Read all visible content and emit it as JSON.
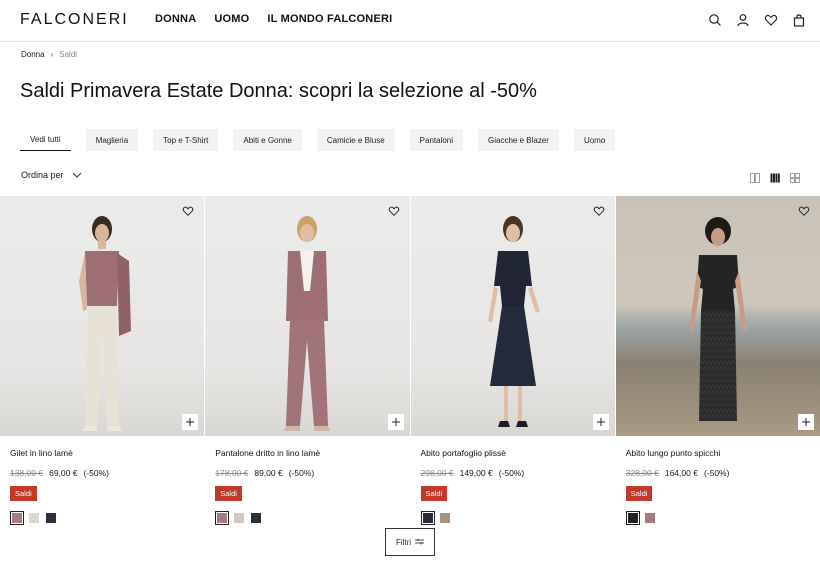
{
  "brand": "FALCONERI",
  "nav": [
    "DONNA",
    "UOMO",
    "IL MONDO FALCONERI"
  ],
  "header_icons": [
    "search-icon",
    "account-icon",
    "wishlist-icon",
    "bag-icon"
  ],
  "breadcrumb": {
    "root": "Donna",
    "separator": "›",
    "current": "Saldi"
  },
  "title": "Saldi Primavera Estate Donna: scopri la selezione al -50%",
  "chips": [
    "Vedi tutti",
    "Maglieria",
    "Top e T-Shirt",
    "Abiti e Gonne",
    "Camicie e Bluse",
    "Pantaloni",
    "Giacche e Blazer",
    "Uomo"
  ],
  "sort_label": "Ordina per",
  "view_icons": [
    "grid-2-icon",
    "grid-4-icon",
    "grid-6-icon"
  ],
  "badge_label": "Saldi",
  "filter_label": "Filtri",
  "products": [
    {
      "name": "Gilet in lino lamè",
      "old_price": "138,00 €",
      "new_price": "69,00 €",
      "discount": "(-50%)",
      "swatches": [
        "#a87b82",
        "#dcd8d0",
        "#2b2f38"
      ]
    },
    {
      "name": "Pantalone dritto in lino lamè",
      "old_price": "178,00 €",
      "new_price": "89,00 €",
      "discount": "(-50%)",
      "swatches": [
        "#a87b82",
        "#cfc9bb",
        "#2b2f38"
      ]
    },
    {
      "name": "Abito portafoglio plissè",
      "old_price": "298,00 €",
      "new_price": "149,00 €",
      "discount": "(-50%)",
      "swatches": [
        "#262a35",
        "#a8917e"
      ]
    },
    {
      "name": "Abito lungo punto spicchi",
      "old_price": "328,00 €",
      "new_price": "164,00 €",
      "discount": "(-50%)",
      "swatches": [
        "#222222",
        "#a87b82"
      ]
    }
  ]
}
